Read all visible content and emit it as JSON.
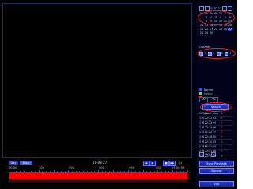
{
  "calendar": {
    "year": "2010",
    "month": "11",
    "weekdays": [
      "Su",
      "Mo",
      "Tu",
      "We",
      "Th",
      "Fr",
      "Sa"
    ],
    "weeks": [
      [
        "",
        "1",
        "2",
        "3",
        "4",
        "5",
        "6"
      ],
      [
        "7",
        "8",
        "9",
        "10",
        "11",
        "12",
        "13"
      ],
      [
        "14",
        "15",
        "16",
        "17",
        "18",
        "19",
        "20"
      ],
      [
        "21",
        "22",
        "23",
        "24",
        "25",
        "26",
        "27"
      ],
      [
        "28",
        "29",
        "30",
        "",
        "",
        "",
        ""
      ]
    ],
    "selected_day": "27"
  },
  "channel": {
    "label": "Channel",
    "items": [
      "1",
      "2",
      "3",
      "4"
    ],
    "checked": [
      true,
      true,
      true,
      true
    ]
  },
  "legend": {
    "items": [
      {
        "label": "Normal",
        "color": "#2f58ff"
      },
      {
        "label": "Motion",
        "color": "#57e06a"
      },
      {
        "label": "Alarm",
        "color": "#ff2e2e"
      }
    ],
    "time_from": "00",
    "time_to": "00"
  },
  "search_button": "Search",
  "table": {
    "headers": [
      "Ch",
      "Type",
      "Start",
      "Stop",
      "S"
    ],
    "rows": [
      [
        "1",
        "R",
        "22:22",
        "23",
        "R"
      ],
      [
        "1",
        "R",
        "22:23",
        "24",
        "R"
      ],
      [
        "1",
        "R",
        "22:24",
        "26",
        "R"
      ],
      [
        "1",
        "R",
        "22:26",
        "27",
        "R"
      ],
      [
        "2",
        "R",
        "22:28",
        "30",
        "R"
      ],
      [
        "2",
        "R",
        "22:30",
        "33",
        "G"
      ],
      [
        "2",
        "R",
        "22:35",
        "36",
        "R"
      ],
      [
        "2",
        "R",
        "22:41",
        "46",
        "R"
      ],
      [
        "2",
        "R",
        "22:46",
        "49",
        "G"
      ]
    ],
    "page": "1/1"
  },
  "sync_playback_button": "Sync Playback",
  "backup_button": "Backup",
  "exit_button": "Exit",
  "timeline": {
    "day_tab": "Day",
    "hour_tab": "Hour",
    "date": "11-03-27",
    "ruler_labels": [
      "00:00",
      "100",
      "200",
      "300",
      "400",
      "500",
      "23:59:59"
    ],
    "controls": [
      "◀",
      "▶",
      "■",
      "▶▶"
    ],
    "zoom": "1/1"
  },
  "colors": {
    "record_bar": "#ff0000",
    "accent": "#2f58ff"
  }
}
